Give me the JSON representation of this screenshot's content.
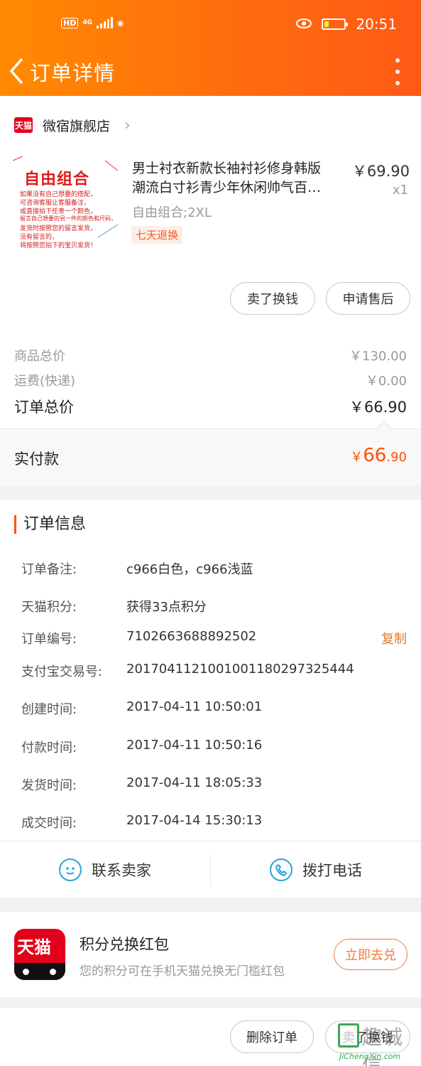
{
  "status_bar": {
    "hd": "HD",
    "network": "4G",
    "time": "20:51"
  },
  "nav": {
    "title": "订单详情"
  },
  "store": {
    "badge": "天猫",
    "name": "微宿旗舰店"
  },
  "product": {
    "image_title": "自由组合",
    "image_lines": [
      "如果没有自己想要的搭配，",
      "可咨询客服让客服备注，",
      "或直接拍下任意一个颜色，",
      "留言自己想要的另一件的颜色和尺码，",
      "发货时按照您的留言发货，",
      "没有留言的，",
      "将按照您拍下的宝贝发货！"
    ],
    "title_line1": "男士衬衣新款长袖衬衫修身韩版",
    "title_line2": "潮流白寸衫青少年休闲帅气百…",
    "price": "￥69.90",
    "qty": "x1",
    "sku": "自由组合;2XL",
    "tag": "七天退换"
  },
  "actions": {
    "sell_label": "卖了换钱",
    "after_sale_label": "申请售后"
  },
  "summary": {
    "goods_label": "商品总价",
    "goods_value": "￥130.00",
    "freight_label": "运费(快递)",
    "freight_value": "￥0.00",
    "order_total_label": "订单总价",
    "order_total_value": "￥66.90",
    "paid_label": "实付款",
    "paid_currency": "￥",
    "paid_int": "66",
    "paid_dec": ".90"
  },
  "order_info": {
    "title": "订单信息",
    "rows": [
      {
        "k": "订单备注:",
        "v": "c966白色，c966浅蓝"
      },
      {
        "k": "天猫积分:",
        "v": "获得33点积分"
      },
      {
        "k": "订单编号:",
        "v": "7102663688892502"
      },
      {
        "k": "支付宝交易号:",
        "v": "2017041121001001180297325444"
      },
      {
        "k": "创建时间:",
        "v": "2017-04-11 10:50:01"
      },
      {
        "k": "付款时间:",
        "v": "2017-04-11 10:50:16"
      },
      {
        "k": "发货时间:",
        "v": "2017-04-11 18:05:33"
      },
      {
        "k": "成交时间:",
        "v": "2017-04-14 15:30:13"
      }
    ],
    "copy_label": "复制"
  },
  "contact": {
    "seller_label": "联系卖家",
    "phone_label": "拨打电话"
  },
  "promo": {
    "icon_text": "天猫",
    "title": "积分兑换红包",
    "subtitle": "您的积分可在手机天猫兑换无门槛红包",
    "button_label": "立即去兑"
  },
  "bottom_bar": {
    "delete_label": "删除订单",
    "sell_label": "卖了换钱"
  },
  "watermark": {
    "text": "趣诚信",
    "url": "JiChengXin.com"
  },
  "colors": {
    "header": "#ff6a10",
    "accent": "#ff5000",
    "link": "#e07a2a",
    "icon_blue": "#2aa4d8"
  }
}
